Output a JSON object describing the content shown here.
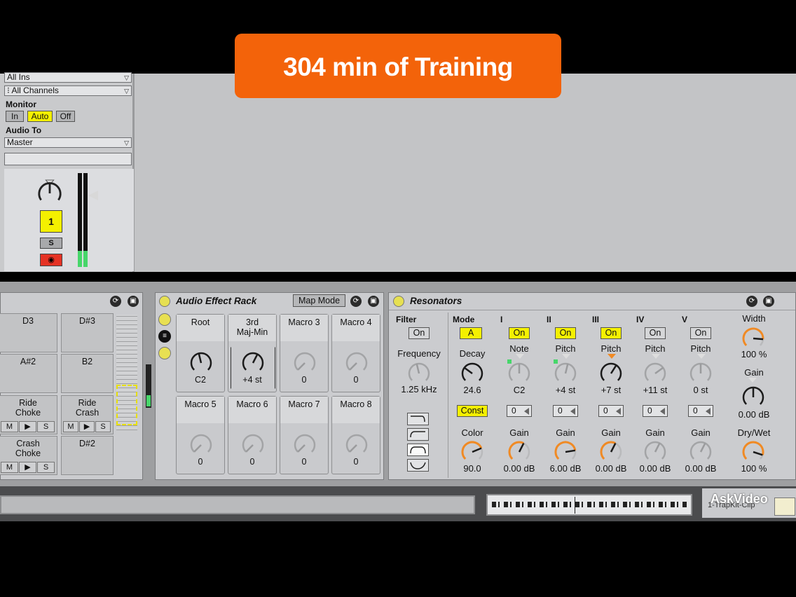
{
  "banner": {
    "text": "304 min of Training"
  },
  "track": {
    "input_channel": "All Ins",
    "channels": "All Channels",
    "monitor_label": "Monitor",
    "monitor_in": "In",
    "monitor_auto": "Auto",
    "monitor_off": "Off",
    "audio_to_label": "Audio To",
    "audio_to": "Master",
    "number": "1",
    "solo": "S",
    "meter_level": 0.17
  },
  "drum_rack": {
    "pads": [
      {
        "name": "D3"
      },
      {
        "name": "D#3"
      },
      {
        "name": "A#2"
      },
      {
        "name": "B2"
      },
      {
        "name": "Ride\nChoke",
        "m": "M",
        "s": "S"
      },
      {
        "name": "Ride\nCrash",
        "m": "M",
        "s": "S"
      },
      {
        "name": "Crash\nChoke",
        "m": "M",
        "s": "S"
      },
      {
        "name": "D#2"
      }
    ]
  },
  "audio_effect_rack": {
    "title": "Audio Effect Rack",
    "map_mode": "Map Mode",
    "macros": [
      {
        "name": "Root",
        "value": "C2",
        "level": 0.45
      },
      {
        "name": "3rd\nMaj-Min",
        "value": "+4 st",
        "level": 0.6
      },
      {
        "name": "Macro  3",
        "value": "0",
        "level": 0.0
      },
      {
        "name": "Macro  4",
        "value": "0",
        "level": 0.0
      },
      {
        "name": "Macro  5",
        "value": "0",
        "level": 0.0
      },
      {
        "name": "Macro  6",
        "value": "0",
        "level": 0.0
      },
      {
        "name": "Macro  7",
        "value": "0",
        "level": 0.0
      },
      {
        "name": "Macro  8",
        "value": "0",
        "level": 0.0
      }
    ]
  },
  "resonators": {
    "title": "Resonators",
    "filter_label": "Filter",
    "filter_on": "On",
    "frequency_label": "Frequency",
    "frequency_value": "1.25 kHz",
    "mode_label": "Mode",
    "mode_value": "A",
    "decay_label": "Decay",
    "decay_value": "24.6",
    "const_label": "Const",
    "color_label": "Color",
    "color_value": "90.0",
    "voices": [
      {
        "numeral": "I",
        "on": "On",
        "on_active": true,
        "pitch_label": "Note",
        "pitch_value": "C2",
        "fine": "0",
        "gain_label": "Gain",
        "gain_value": "0.00 dB"
      },
      {
        "numeral": "II",
        "on": "On",
        "on_active": true,
        "pitch_label": "Pitch",
        "pitch_value": "+4 st",
        "fine": "0",
        "gain_label": "Gain",
        "gain_value": "6.00 dB"
      },
      {
        "numeral": "III",
        "on": "On",
        "on_active": true,
        "pitch_label": "Pitch",
        "pitch_value": "+7 st",
        "fine": "0",
        "gain_label": "Gain",
        "gain_value": "0.00 dB"
      },
      {
        "numeral": "IV",
        "on": "On",
        "on_active": false,
        "pitch_label": "Pitch",
        "pitch_value": "+11 st",
        "fine": "0",
        "gain_label": "Gain",
        "gain_value": "0.00 dB"
      },
      {
        "numeral": "V",
        "on": "On",
        "on_active": false,
        "pitch_label": "Pitch",
        "pitch_value": "0 st",
        "fine": "0",
        "gain_label": "Gain",
        "gain_value": "0.00 dB"
      }
    ],
    "width_label": "Width",
    "width_value": "100 %",
    "gain_label": "Gain",
    "gain_value": "0.00 dB",
    "drywet_label": "Dry/Wet",
    "drywet_value": "100 %"
  },
  "footer": {
    "watermark": "AskVideo",
    "clip_name": "1-TrapKit-Clip"
  },
  "colors": {
    "banner": "#f3630a",
    "active_button": "#f4f000",
    "knob_orange": "#f08a24",
    "meter_green": "#47d66a",
    "arm_red": "#e53224"
  }
}
